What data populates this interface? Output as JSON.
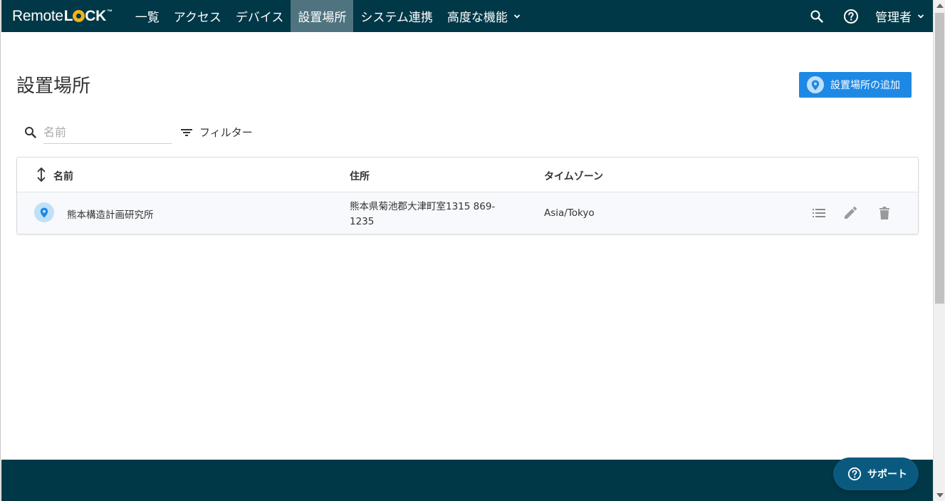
{
  "brand": {
    "remote": "Remote",
    "l": "L",
    "ck": "CK",
    "tm": "™"
  },
  "nav": {
    "items": [
      {
        "label": "一覧",
        "active": false
      },
      {
        "label": "アクセス",
        "active": false
      },
      {
        "label": "デバイス",
        "active": false
      },
      {
        "label": "設置場所",
        "active": true
      },
      {
        "label": "システム連携",
        "active": false
      },
      {
        "label": "高度な機能",
        "active": false
      }
    ],
    "admin_label": "管理者"
  },
  "page": {
    "title": "設置場所",
    "add_button_label": "設置場所の追加"
  },
  "search": {
    "placeholder": "名前",
    "value": ""
  },
  "filter": {
    "label": "フィルター"
  },
  "table": {
    "headers": {
      "name": "名前",
      "address": "住所",
      "timezone": "タイムゾーン"
    },
    "rows": [
      {
        "name": "熊本構造計画研究所",
        "address_line1": "熊本県菊池郡大津町室1315 869-",
        "address_line2": "1235",
        "timezone": "Asia/Tokyo"
      }
    ]
  },
  "support": {
    "label": "サポート"
  },
  "colors": {
    "nav_bg": "#003847",
    "nav_active": "#4f7480",
    "primary": "#1e88e5",
    "icon_bg": "#bfe0f7",
    "logo_accent": "#f3b21b"
  }
}
